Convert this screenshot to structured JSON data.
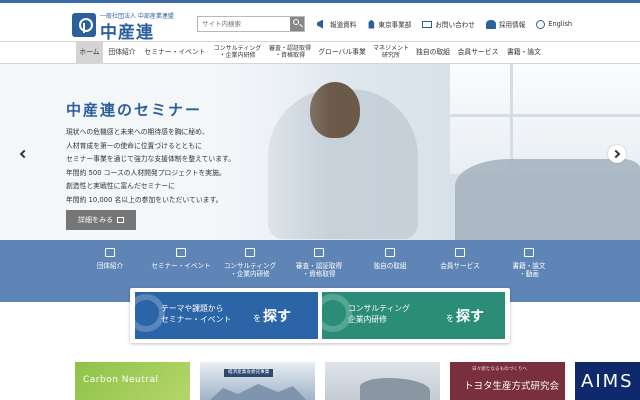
{
  "header": {
    "logo_sub": "一般社団法人 中部産業連盟",
    "logo_main": "中産連",
    "search_placeholder": "サイト内検索",
    "links": [
      {
        "label": "報道資料",
        "icon": "megaphone-icon"
      },
      {
        "label": "東京事業部",
        "icon": "building-icon"
      },
      {
        "label": "お問い合わせ",
        "icon": "mail-icon"
      },
      {
        "label": "採用情報",
        "icon": "people-icon"
      },
      {
        "label": "English",
        "icon": "globe-icon"
      }
    ]
  },
  "nav": {
    "items": [
      {
        "label": "ホーム"
      },
      {
        "label": "団体紹介"
      },
      {
        "label": "セミナー・イベント"
      },
      {
        "line1": "コンサルティング",
        "line2": "・企業内研修"
      },
      {
        "line1": "審査・認証取得",
        "line2": "・資格取得"
      },
      {
        "label": "グローバル事業"
      },
      {
        "line1": "マネジメント",
        "line2": "研究所"
      },
      {
        "label": "独自の取組"
      },
      {
        "label": "会員サービス"
      },
      {
        "label": "書籍・論文"
      }
    ]
  },
  "hero": {
    "title": "中産連のセミナー",
    "lines": [
      "現状への危機感と未来への期待感を胸に秘め、",
      "人材育成を第一の使命に位置づけるとともに",
      "セミナー事業を通じて強力な支援体制を整えています。",
      "年間約 500 コースの人材開発プロジェクトを実施。",
      "創造性と実戦性に富んだセミナーに",
      "年間約 10,000 名以上の参加をいただいています。"
    ],
    "button": "詳細をみる"
  },
  "categories": [
    {
      "line1": "団体紹介",
      "line2": ""
    },
    {
      "line1": "セミナー・イベント",
      "line2": ""
    },
    {
      "line1": "コンサルティング",
      "line2": "・企業内研修"
    },
    {
      "line1": "審査・認証取得",
      "line2": "・資格取得"
    },
    {
      "line1": "独自の取組",
      "line2": ""
    },
    {
      "line1": "会員サービス",
      "line2": ""
    },
    {
      "line1": "書籍・論文",
      "line2": "・動画"
    }
  ],
  "search_panel": {
    "left": {
      "line1": "テーマや課題から",
      "line2": "セミナー・イベント",
      "particle": "を",
      "action": "探す"
    },
    "right": {
      "line1": "コンサルティング",
      "line2": "企業内研修",
      "particle": "を",
      "action": "探す"
    }
  },
  "banners": {
    "carbon": "Carbon Neutral",
    "meti": "経済産業省委託事業",
    "toyota_top": "日々新たなるものづくりへ",
    "toyota_main": "トヨタ生産方式研究会",
    "aims": "AIMS"
  },
  "colors": {
    "brand": "#2c5f9e",
    "band": "#5f84b6",
    "search_left": "#2c64a8",
    "search_right": "#2b8c78"
  }
}
